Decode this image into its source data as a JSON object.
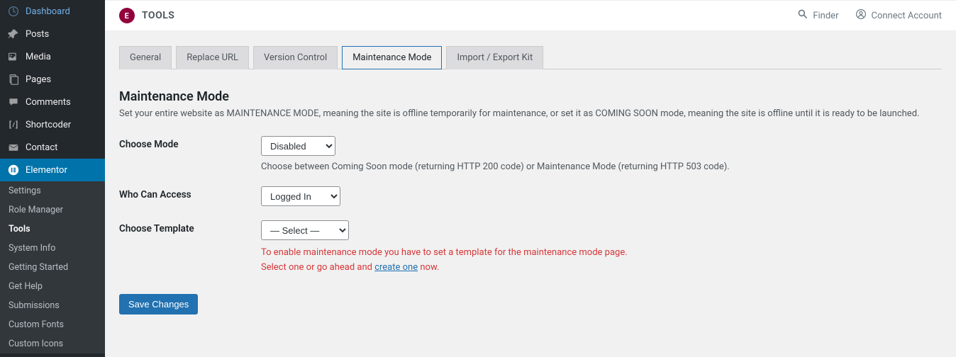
{
  "sidebar": {
    "items": [
      {
        "label": "Dashboard",
        "icon": "dashboard"
      },
      {
        "label": "Posts",
        "icon": "pin"
      },
      {
        "label": "Media",
        "icon": "media"
      },
      {
        "label": "Pages",
        "icon": "pages"
      },
      {
        "label": "Comments",
        "icon": "comment"
      },
      {
        "label": "Shortcoder",
        "icon": "shortcode"
      },
      {
        "label": "Contact",
        "icon": "mail"
      },
      {
        "label": "Elementor",
        "icon": "elementor",
        "active": true
      }
    ],
    "submenu": [
      {
        "label": "Settings"
      },
      {
        "label": "Role Manager"
      },
      {
        "label": "Tools",
        "active": true
      },
      {
        "label": "System Info"
      },
      {
        "label": "Getting Started"
      },
      {
        "label": "Get Help"
      },
      {
        "label": "Submissions"
      },
      {
        "label": "Custom Fonts"
      },
      {
        "label": "Custom Icons"
      }
    ]
  },
  "topbar": {
    "title": "TOOLS",
    "finder": "Finder",
    "connect": "Connect Account"
  },
  "tabs": [
    {
      "label": "General"
    },
    {
      "label": "Replace URL"
    },
    {
      "label": "Version Control"
    },
    {
      "label": "Maintenance Mode",
      "active": true
    },
    {
      "label": "Import / Export Kit"
    }
  ],
  "section": {
    "title": "Maintenance Mode",
    "desc": "Set your entire website as MAINTENANCE MODE, meaning the site is offline temporarily for maintenance, or set it as COMING SOON mode, meaning the site is offline until it is ready to be launched."
  },
  "form": {
    "mode": {
      "label": "Choose Mode",
      "value": "Disabled",
      "help": "Choose between Coming Soon mode (returning HTTP 200 code) or Maintenance Mode (returning HTTP 503 code)."
    },
    "access": {
      "label": "Who Can Access",
      "value": "Logged In"
    },
    "template": {
      "label": "Choose Template",
      "value": "— Select —",
      "warn1": "To enable maintenance mode you have to set a template for the maintenance mode page.",
      "warn2a": "Select one or go ahead and ",
      "warn2link": "create one",
      "warn2b": " now."
    }
  },
  "save": "Save Changes"
}
